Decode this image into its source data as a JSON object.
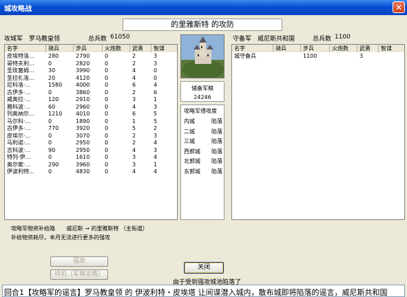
{
  "window": {
    "title": "城攻略战"
  },
  "battle_title": "的里雅斯特 的攻防",
  "attacker": {
    "label": "攻城军",
    "commander": "罗马教皇领",
    "total_label": "总兵数",
    "total": "61050",
    "columns": [
      "名字",
      "骑兵",
      "步兵",
      "火炮数",
      "武勇",
      "智谋"
    ],
    "rows": [
      [
        "皮埃特洛…",
        "280",
        "2790",
        "0",
        "2",
        "3"
      ],
      [
        "哥特夫利…",
        "0",
        "2820",
        "0",
        "2",
        "3"
      ],
      [
        "圣玫塞姆…",
        "30",
        "3990",
        "0",
        "4",
        "0"
      ],
      [
        "圣拉扎洛…",
        "20",
        "4120",
        "0",
        "4",
        "0"
      ],
      [
        "尼科洛·…",
        "1580",
        "4000",
        "0",
        "6",
        "4"
      ],
      [
        "古伊多·…",
        "0",
        "3860",
        "0",
        "2",
        "6"
      ],
      [
        "威奥拉·…",
        "120",
        "2910",
        "0",
        "3",
        "1"
      ],
      [
        "雅科波·…",
        "60",
        "2960",
        "0",
        "4",
        "3"
      ],
      [
        "列奥纳尔…",
        "1210",
        "4010",
        "0",
        "6",
        "5"
      ],
      [
        "马尔科·…",
        "0",
        "1890",
        "0",
        "1",
        "5"
      ],
      [
        "古伊多·…",
        "770",
        "3920",
        "0",
        "5",
        "2"
      ],
      [
        "皮埃尔·…",
        "0",
        "3070",
        "0",
        "2",
        "3"
      ],
      [
        "马利诺·…",
        "0",
        "2950",
        "0",
        "2",
        "4"
      ],
      [
        "吉科波·…",
        "90",
        "2950",
        "0",
        "4",
        "3"
      ],
      [
        "特列·伊…",
        "0",
        "1610",
        "0",
        "3",
        "4"
      ],
      [
        "奥尔索·…",
        "290",
        "3960",
        "0",
        "3",
        "1"
      ],
      [
        "伊波利特…",
        "0",
        "4830",
        "0",
        "4",
        "4"
      ]
    ]
  },
  "defender": {
    "label": "守备军",
    "commander": "威尼斯共和国",
    "total_label": "总兵数",
    "total": "1100",
    "columns": [
      "名字",
      "骑兵",
      "步兵",
      "火炮数",
      "武勇",
      "智谋"
    ],
    "rows": [
      [
        "城守备兵",
        "",
        "1100",
        "",
        "3",
        ""
      ]
    ]
  },
  "grain": {
    "label": "储备军粮",
    "value": "24246"
  },
  "progress": {
    "label": "攻略军侵攻度",
    "cities": [
      {
        "name": "内城",
        "status": "陷落"
      },
      {
        "name": "二城",
        "status": "陷落"
      },
      {
        "name": "三城",
        "status": "陷落"
      },
      {
        "name": "西郭城",
        "status": "陷落"
      },
      {
        "name": "北郭城",
        "status": "陷落"
      },
      {
        "name": "东郭城",
        "status": "陷落"
      }
    ]
  },
  "supply": {
    "label": "攻略军物资补给路",
    "route": "威尼斯 → 的里雅斯特 （主街道）",
    "note": "补给物资耗尽，本月无法进行更多的强攻"
  },
  "buttons": {
    "assault": "强攻",
    "wait": "待机（军粮攻略）",
    "close": "关闭"
  },
  "status_message": "由于受到强攻城池陷落了",
  "log": "回合1【攻略军的谣言】罗马教皇领 的 伊波利特・皮埃塔 让间谍潜入城内，散布城即将陷落的谣言，威尼斯共和国"
}
